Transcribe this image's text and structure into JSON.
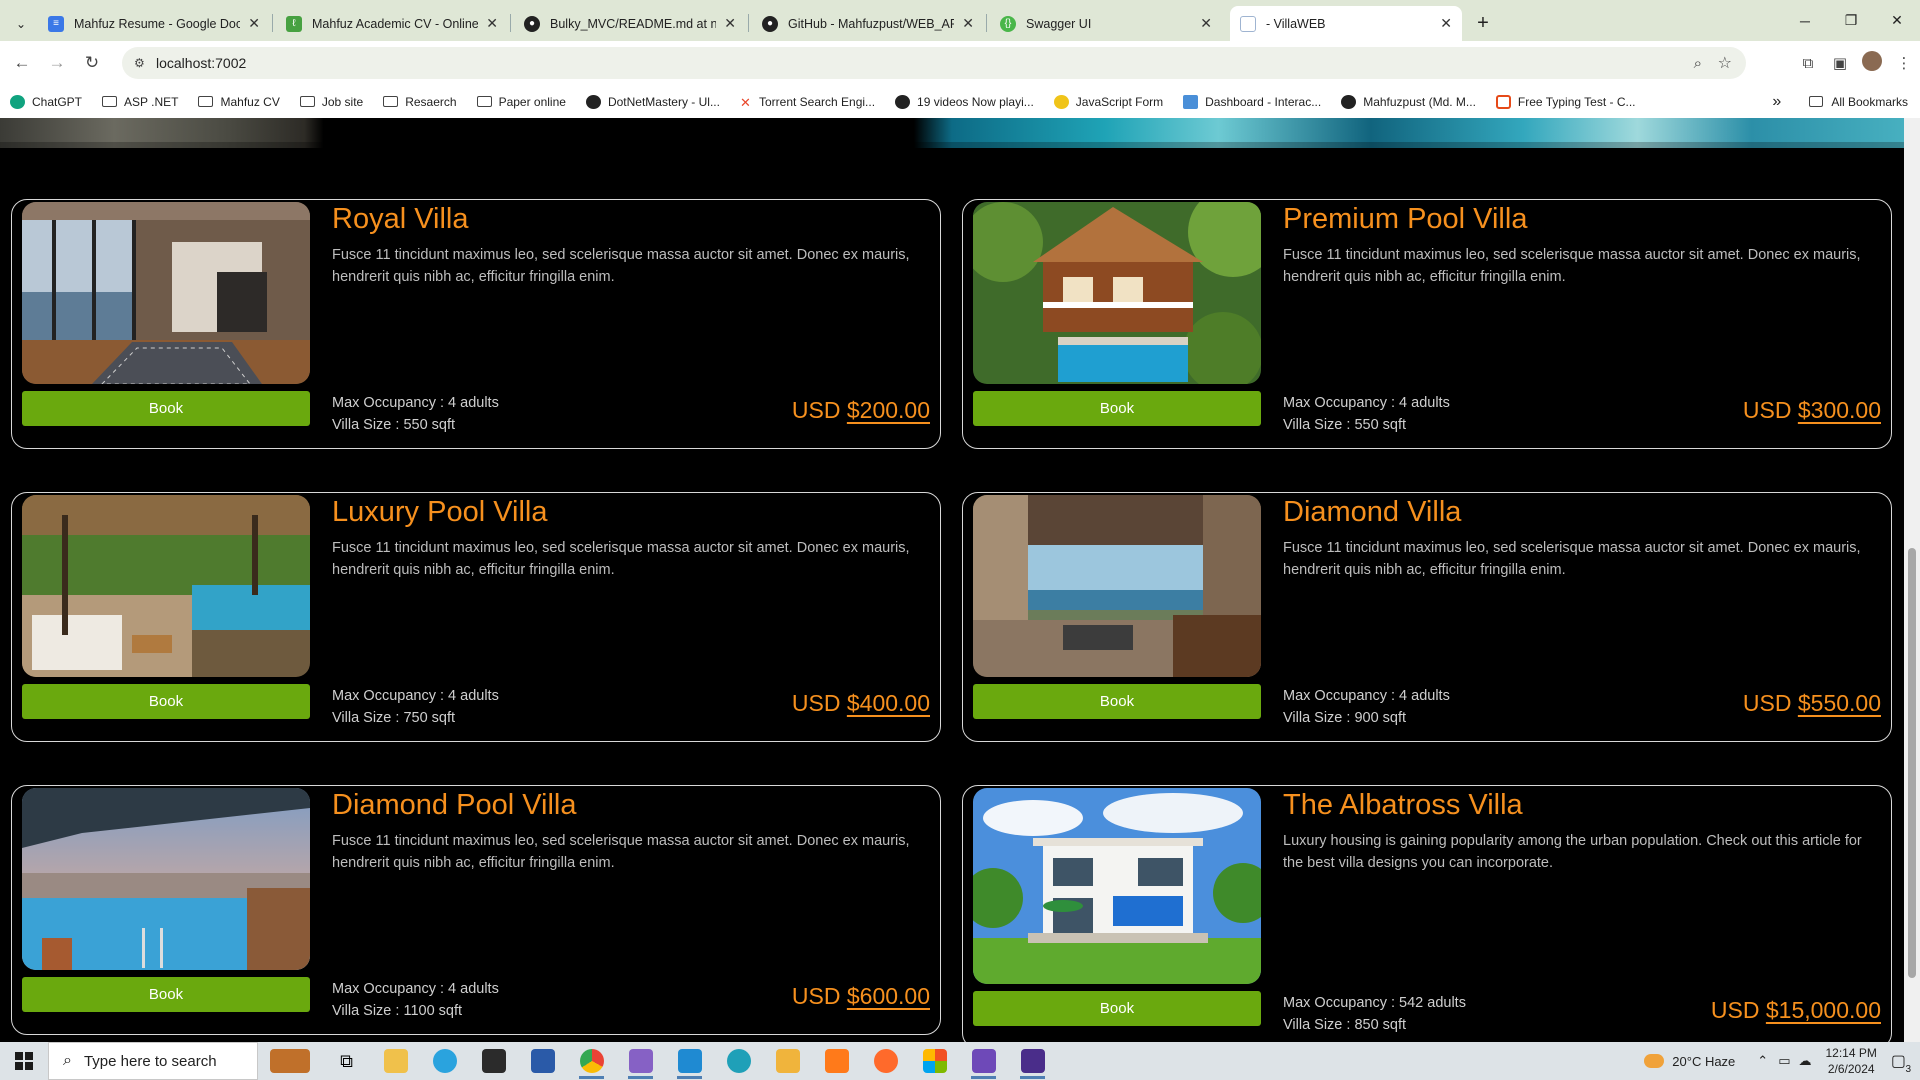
{
  "browser": {
    "tabs": [
      {
        "title": "Mahfuz Resume - Google Docs",
        "icon": "google-docs-icon",
        "color": "#3b78e7",
        "active": false
      },
      {
        "title": "Mahfuz Academic CV - Online LaTeX",
        "icon": "overleaf-icon",
        "color": "#47a141",
        "active": false
      },
      {
        "title": "Bulky_MVC/README.md at new",
        "icon": "github-icon",
        "color": "#222222",
        "active": false
      },
      {
        "title": "GitHub - Mahfuzpust/WEB_API",
        "icon": "github-icon",
        "color": "#222222",
        "active": false
      },
      {
        "title": "Swagger UI",
        "icon": "swagger-icon",
        "color": "#49b649",
        "active": false
      },
      {
        "title": "- VillaWEB",
        "icon": "page-icon",
        "color": "#9fb4d1",
        "active": true
      }
    ],
    "url": "localhost:7002",
    "bookmarks": [
      {
        "label": "ChatGPT",
        "icon": "chatgpt-icon",
        "color": "#10a37f"
      },
      {
        "label": "ASP .NET",
        "icon": "folder-icon",
        "color": ""
      },
      {
        "label": "Mahfuz CV",
        "icon": "folder-icon",
        "color": ""
      },
      {
        "label": "Job site",
        "icon": "folder-icon",
        "color": ""
      },
      {
        "label": "Resaerch",
        "icon": "folder-icon",
        "color": ""
      },
      {
        "label": "Paper online",
        "icon": "folder-icon",
        "color": ""
      },
      {
        "label": "DotNetMastery - Ul...",
        "icon": "dotnet-icon",
        "color": "#222222"
      },
      {
        "label": "Torrent Search Engi...",
        "icon": "torrent-icon",
        "color": "#e8472b"
      },
      {
        "label": "19 videos Now playi...",
        "icon": "video-icon",
        "color": "#222222"
      },
      {
        "label": "JavaScript Form",
        "icon": "js-icon",
        "color": "#f0c419"
      },
      {
        "label": "Dashboard - Interac...",
        "icon": "dashboard-icon",
        "color": "#4a8fd8"
      },
      {
        "label": "Mahfuzpust (Md. M...",
        "icon": "github-icon",
        "color": "#222222"
      },
      {
        "label": "Free Typing Test - C...",
        "icon": "typing-icon",
        "color": "#e64a19"
      }
    ],
    "all_bookmarks": "All Bookmarks",
    "more_bookmarks": "»"
  },
  "villas": [
    {
      "name": "Royal Villa",
      "description": "Fusce 11 tincidunt maximus leo, sed scelerisque massa auctor sit amet. Donec ex mauris, hendrerit quis nibh ac, efficitur fringilla enim.",
      "occupancy": "Max Occupancy : 4 adults",
      "size": "Villa Size : 550 sqft",
      "currency": "USD",
      "price": "$200.00",
      "book": "Book",
      "image": "royal-villa-interior-image"
    },
    {
      "name": "Premium Pool Villa",
      "description": "Fusce 11 tincidunt maximus leo, sed scelerisque massa auctor sit amet. Donec ex mauris, hendrerit quis nibh ac, efficitur fringilla enim.",
      "occupancy": "Max Occupancy : 4 adults",
      "size": "Villa Size : 550 sqft",
      "currency": "USD",
      "price": "$300.00",
      "book": "Book",
      "image": "premium-pool-villa-image"
    },
    {
      "name": "Luxury Pool Villa",
      "description": "Fusce 11 tincidunt maximus leo, sed scelerisque massa auctor sit amet. Donec ex mauris, hendrerit quis nibh ac, efficitur fringilla enim.",
      "occupancy": "Max Occupancy : 4 adults",
      "size": "Villa Size : 750 sqft",
      "currency": "USD",
      "price": "$400.00",
      "book": "Book",
      "image": "luxury-pool-villa-image"
    },
    {
      "name": "Diamond Villa",
      "description": "Fusce 11 tincidunt maximus leo, sed scelerisque massa auctor sit amet. Donec ex mauris, hendrerit quis nibh ac, efficitur fringilla enim.",
      "occupancy": "Max Occupancy : 4 adults",
      "size": "Villa Size : 900 sqft",
      "currency": "USD",
      "price": "$550.00",
      "book": "Book",
      "image": "diamond-villa-image"
    },
    {
      "name": "Diamond Pool Villa",
      "description": "Fusce 11 tincidunt maximus leo, sed scelerisque massa auctor sit amet. Donec ex mauris, hendrerit quis nibh ac, efficitur fringilla enim.",
      "occupancy": "Max Occupancy : 4 adults",
      "size": "Villa Size : 1100 sqft",
      "currency": "USD",
      "price": "$600.00",
      "book": "Book",
      "image": "diamond-pool-villa-image"
    },
    {
      "name": "The Albatross Villa",
      "description": "Luxury housing is gaining popularity among the urban population. Check out this article for the best villa designs you can incorporate.",
      "occupancy": "Max Occupancy : 542 adults",
      "size": "Villa Size : 850 sqft",
      "currency": "USD",
      "price": "$15,000.00",
      "book": "Book",
      "image": "albatross-villa-image"
    }
  ],
  "colors": {
    "accent": "#f6901e",
    "book_button": "#6aa90e"
  },
  "taskbar": {
    "search_placeholder": "Type here to search",
    "weather": "20°C  Haze",
    "time": "12:14 PM",
    "date": "2/6/2024",
    "notifications": "3"
  }
}
